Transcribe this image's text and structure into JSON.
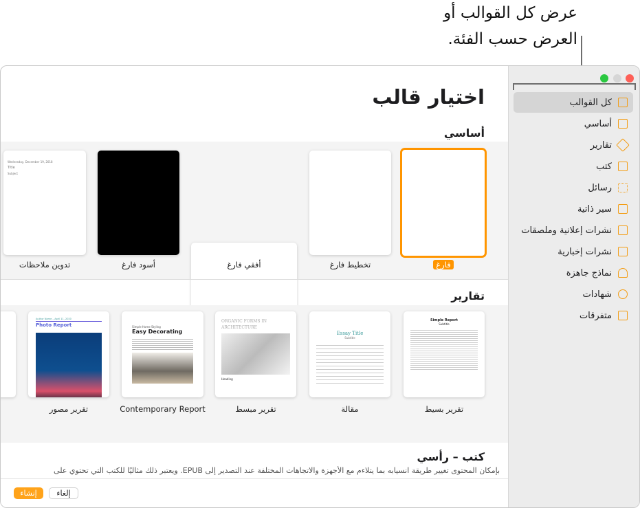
{
  "callout": {
    "line1": "عرض كل القوالب أو",
    "line2": "العرض حسب الفئة."
  },
  "window": {
    "title": "اختيار قالب"
  },
  "sidebar": {
    "items": [
      {
        "label": "كل القوالب",
        "icon": "grid-icon",
        "selected": true
      },
      {
        "label": "أساسي",
        "icon": "document-icon"
      },
      {
        "label": "تقارير",
        "icon": "graduation-cap-icon"
      },
      {
        "label": "كتب",
        "icon": "book-icon"
      },
      {
        "label": "رسائل",
        "icon": "stamp-icon"
      },
      {
        "label": "سير ذاتية",
        "icon": "resume-icon"
      },
      {
        "label": "نشرات إعلانية وملصقات",
        "icon": "map-icon"
      },
      {
        "label": "نشرات إخبارية",
        "icon": "newspaper-icon"
      },
      {
        "label": "نماذج جاهزة",
        "icon": "stamp-form-icon"
      },
      {
        "label": "شهادات",
        "icon": "ribbon-icon"
      },
      {
        "label": "متفرقات",
        "icon": "archive-box-icon"
      }
    ]
  },
  "sections": {
    "basic": {
      "title": "أساسي",
      "templates": [
        "فارغ",
        "تخطيط فارغ",
        "أفقي فارغ",
        "أسود فارغ",
        "تدوين ملاحظات"
      ]
    },
    "reports": {
      "title": "تقارير",
      "templates": [
        "تقرير بسيط",
        "مقالة",
        "تقرير مبسط",
        "Contemporary Report",
        "تقرير مصور"
      ]
    },
    "books": {
      "title": "كتب – رأسي",
      "description": "بإمكان المحتوى تغيير طريقة انسيابه بما يتلاءم مع الأجهزة والاتجاهات المختلفة عند التصدير إلى EPUB. ويعتبر ذلك مثاليًا للكتب التي تحتوي على"
    }
  },
  "thumbs": {
    "photo_report": {
      "meta": "Author Name – April 11, 2020",
      "title": "Photo Report"
    },
    "contemporary": {
      "kicker": "Simple Home Styling",
      "title": "Easy Decorating"
    },
    "simplified": {
      "title": "ORGANIC FORMS IN ARCHITECTURE",
      "heading": "Heading"
    },
    "essay": {
      "title": "Essay Title",
      "subtitle": "Subtitle"
    },
    "simple": {
      "title": "Simple Report",
      "subtitle": "Subtitle"
    },
    "notes": {
      "date": "Wednesday, December 19, 2018",
      "title": "Title",
      "subtitle": "Subject"
    }
  },
  "footer": {
    "cancel": "إلغاء",
    "create": "إنشاء"
  },
  "colors": {
    "accent": "#ff9500",
    "sidebar": "#ececec"
  }
}
